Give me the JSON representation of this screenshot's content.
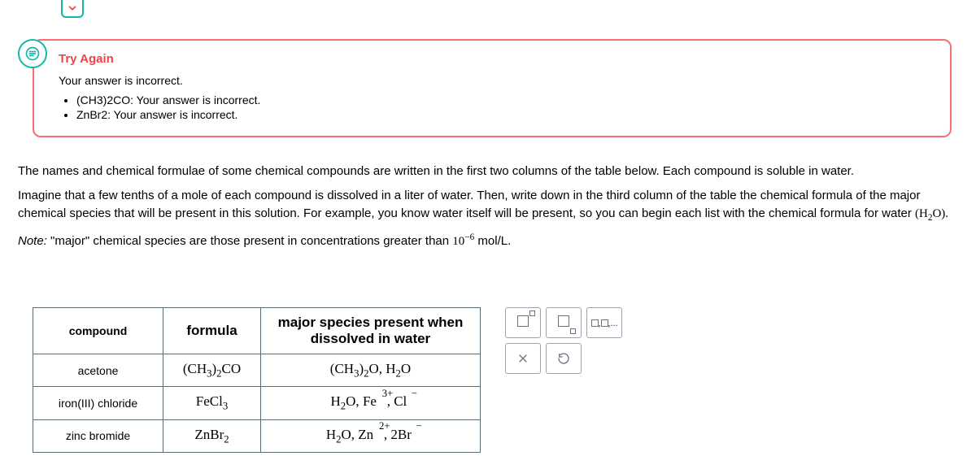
{
  "dropdown": {
    "icon": "chevron-down-icon"
  },
  "feedback": {
    "title": "Try Again",
    "subtitle": "Your answer is incorrect.",
    "items": [
      "(CH3)2CO: Your answer is incorrect.",
      "ZnBr2: Your answer is incorrect."
    ]
  },
  "question": {
    "p1": "The names and chemical formulae of some chemical compounds are written in the first two columns of the table below. Each compound is soluble in water.",
    "p2_a": "Imagine that a few tenths of a mole of each compound is dissolved in a liter of water. Then, write down in the third column of the table the chemical formula of the major chemical species that will be present in this solution. For example, you know water itself will be present, so you can begin each list with the chemical formula for water ",
    "p2_formula": "(H₂O).",
    "note_label": "Note:",
    "note_text_a": " \"major\" chemical species are those present in concentrations greater than ",
    "note_exp": "10⁻⁶",
    "note_text_b": " mol/L."
  },
  "table": {
    "headers": {
      "compound": "compound",
      "formula": "formula",
      "species": "major species present when dissolved in water"
    },
    "rows": [
      {
        "compound": "acetone",
        "formula_html": "(CH₃)₂CO",
        "species_html": "(CH₃)₂O, H₂O"
      },
      {
        "compound": "iron(III) chloride",
        "formula_html": "FeCl₃",
        "species_html": "H₂O, Fe³⁺, Cl⁻"
      },
      {
        "compound": "zinc bromide",
        "formula_html": "ZnBr₂",
        "species_html": "H₂O, Zn²⁺, 2Br⁻"
      }
    ]
  },
  "toolbar": {
    "btn_super": "□▫",
    "btn_sub": "□▫",
    "btn_list": "□,□,...",
    "btn_close": "×",
    "btn_reset": "↺"
  }
}
